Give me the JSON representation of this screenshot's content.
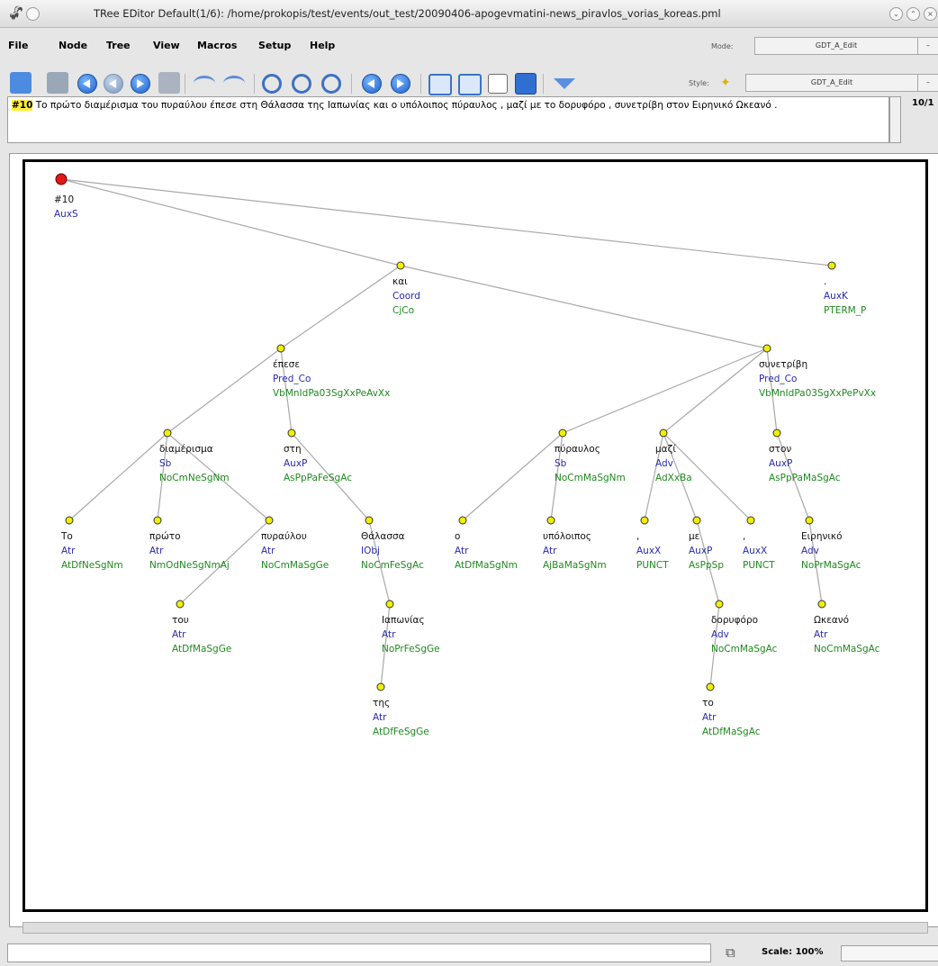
{
  "window": {
    "title": "TRee EDitor   Default(1/6): /home/prokopis/test/events/out_test/20090406-apogevmatini-news_piravlos_vorias_koreas.pml"
  },
  "menu": {
    "items": [
      "File",
      "Node",
      "Tree",
      "View",
      "Macros",
      "Setup",
      "Help"
    ]
  },
  "mode": {
    "label": "Mode:",
    "value": "GDT_A_Edit"
  },
  "style": {
    "label": "Style:",
    "value": "GDT_A_Edit"
  },
  "sentence": {
    "number": "#10",
    "text": "Το πρώτο διαμέρισμα του πυραύλου έπεσε στη Θάλασσα της Ιαπωνίας και ο υπόλοιπος πύραυλος , μαζί με το δορυφόρο , συνετρίβη στον Ειρηνικό Ωκεανό .",
    "counter": "10/1"
  },
  "status": {
    "scale": "Scale: 100%"
  },
  "colors": {
    "root": "#e01818",
    "node": "#f0f000",
    "afun": "#2a2ab0",
    "tag": "#1e8a1e"
  },
  "tree": {
    "root": {
      "id": "#10",
      "afun": "AuxS"
    },
    "nodes": [
      {
        "key": "kai",
        "form": "και",
        "afun": "Coord",
        "tag": "CjCo",
        "parent": "root"
      },
      {
        "key": "final",
        "form": ".",
        "afun": "AuxK",
        "tag": "PTERM_P",
        "parent": "root"
      },
      {
        "key": "epese",
        "form": "έπεσε",
        "afun": "Pred_Co",
        "tag": "VbMnIdPa03SgXxPeAvXx",
        "parent": "kai"
      },
      {
        "key": "synetrivi",
        "form": "συνετρίβη",
        "afun": "Pred_Co",
        "tag": "VbMnIdPa03SgXxPePvXx",
        "parent": "kai"
      },
      {
        "key": "diamerisma",
        "form": "διαμέρισμα",
        "afun": "Sb",
        "tag": "NoCmNeSgNm",
        "parent": "epese"
      },
      {
        "key": "sti",
        "form": "στη",
        "afun": "AuxP",
        "tag": "AsPpPaFeSgAc",
        "parent": "epese"
      },
      {
        "key": "to",
        "form": "Το",
        "afun": "Atr",
        "tag": "AtDfNeSgNm",
        "parent": "diamerisma"
      },
      {
        "key": "proto",
        "form": "πρώτο",
        "afun": "Atr",
        "tag": "NmOdNeSgNmAj",
        "parent": "diamerisma"
      },
      {
        "key": "pyravlou",
        "form": "πυραύλου",
        "afun": "Atr",
        "tag": "NoCmMaSgGe",
        "parent": "diamerisma"
      },
      {
        "key": "tou",
        "form": "του",
        "afun": "Atr",
        "tag": "AtDfMaSgGe",
        "parent": "pyravlou"
      },
      {
        "key": "thalassa",
        "form": "Θάλασσα",
        "afun": "IObj",
        "tag": "NoCmFeSgAc",
        "parent": "sti"
      },
      {
        "key": "iaponias",
        "form": "Ιαπωνίας",
        "afun": "Atr",
        "tag": "NoPrFeSgGe",
        "parent": "thalassa"
      },
      {
        "key": "tis",
        "form": "της",
        "afun": "Atr",
        "tag": "AtDfFeSgGe",
        "parent": "iaponias"
      },
      {
        "key": "pyravlos",
        "form": "πύραυλος",
        "afun": "Sb",
        "tag": "NoCmMaSgNm",
        "parent": "synetrivi"
      },
      {
        "key": "mazi",
        "form": "μαζί",
        "afun": "Adv",
        "tag": "AdXxBa",
        "parent": "synetrivi"
      },
      {
        "key": "ston",
        "form": "στον",
        "afun": "AuxP",
        "tag": "AsPpPaMaSgAc",
        "parent": "synetrivi"
      },
      {
        "key": "o",
        "form": "ο",
        "afun": "Atr",
        "tag": "AtDfMaSgNm",
        "parent": "pyravlos"
      },
      {
        "key": "ypoloipos",
        "form": "υπόλοιπος",
        "afun": "Atr",
        "tag": "AjBaMaSgNm",
        "parent": "pyravlos"
      },
      {
        "key": "comma1",
        "form": ",",
        "afun": "AuxX",
        "tag": "PUNCT",
        "parent": "mazi"
      },
      {
        "key": "me",
        "form": "με",
        "afun": "AuxP",
        "tag": "AsPpSp",
        "parent": "mazi"
      },
      {
        "key": "comma2",
        "form": ",",
        "afun": "AuxX",
        "tag": "PUNCT",
        "parent": "mazi"
      },
      {
        "key": "doryforo",
        "form": "δορυφόρο",
        "afun": "Adv",
        "tag": "NoCmMaSgAc",
        "parent": "me"
      },
      {
        "key": "to2",
        "form": "το",
        "afun": "Atr",
        "tag": "AtDfMaSgAc",
        "parent": "doryforo"
      },
      {
        "key": "eirinikó",
        "form": "Ειρηνικό",
        "afun": "Adv",
        "tag": "NoPrMaSgAc",
        "parent": "ston"
      },
      {
        "key": "okeano",
        "form": "Ωκεανό",
        "afun": "Atr",
        "tag": "NoCmMaSgAc",
        "parent": "eirinikó"
      }
    ]
  }
}
